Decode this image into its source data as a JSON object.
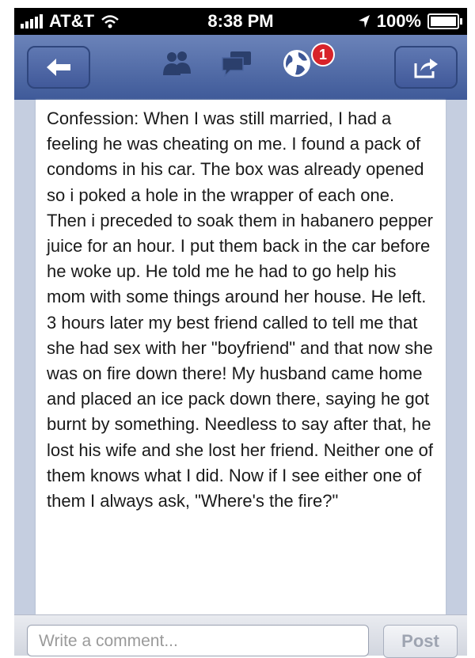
{
  "status_bar": {
    "carrier": "AT&T",
    "time": "8:38 PM",
    "battery": "100%",
    "icons": [
      "signal-icon",
      "wifi-icon",
      "location-arrow-icon",
      "battery-icon"
    ]
  },
  "nav": {
    "icons": [
      "back-arrow-icon",
      "friends-icon",
      "messages-icon",
      "notifications-globe-icon",
      "share-icon"
    ],
    "notification_count": "1"
  },
  "post": {
    "text": "Confession: When I was still married, I had a feeling he was cheating on me. I found a pack of condoms in his car. The box was already opened so i poked a hole in the wrapper of each one. Then i preceded to soak them in habanero pepper juice for an hour. I put them back in the car before he woke up. He told me he had to go help his mom with some things around her house. He left. 3 hours later my best friend called to tell me that she had sex with her \"boyfriend\" and that now she was on fire down there! My husband came home and placed an ice pack down there, saying he got burnt by something. Needless to say after that, he lost his wife and she lost her friend. Neither one of them knows what I did. Now if I see either one of them I always ask, \"Where's the fire?\""
  },
  "comment": {
    "placeholder": "Write a comment...",
    "post_label": "Post"
  },
  "colors": {
    "nav_bar": "#4a649f",
    "badge": "#d8232a",
    "frame": "#c5cee0"
  }
}
